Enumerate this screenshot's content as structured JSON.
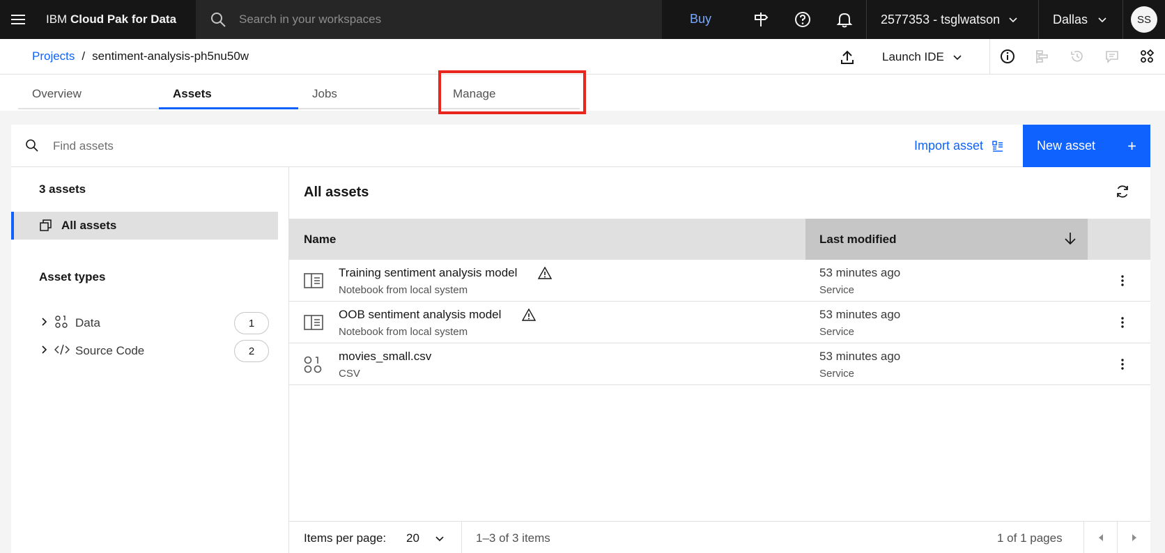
{
  "header": {
    "brand_prefix": "IBM",
    "brand_name": "Cloud Pak for Data",
    "search_placeholder": "Search in your workspaces",
    "buy_label": "Buy",
    "account": "2577353 - tsglwatson",
    "region": "Dallas",
    "avatar_initials": "SS"
  },
  "breadcrumb": {
    "root": "Projects",
    "separator": "/",
    "current": "sentiment-analysis-ph5nu50w"
  },
  "toolbar": {
    "launch_ide": "Launch IDE"
  },
  "tabs": [
    {
      "label": "Overview"
    },
    {
      "label": "Assets"
    },
    {
      "label": "Jobs"
    },
    {
      "label": "Manage"
    }
  ],
  "assetbar": {
    "find_placeholder": "Find assets",
    "import_label": "Import asset",
    "new_label": "New asset",
    "new_plus": "+"
  },
  "sidebar": {
    "count": "3 assets",
    "all_assets": "All assets",
    "types_heading": "Asset types",
    "types": [
      {
        "label": "Data",
        "count": "1"
      },
      {
        "label": "Source Code",
        "count": "2"
      }
    ]
  },
  "main": {
    "title": "All assets",
    "col_name": "Name",
    "col_modified": "Last modified",
    "rows": [
      {
        "name": "Training sentiment analysis model",
        "sub": "Notebook from local system",
        "time": "53 minutes ago",
        "by": "Service",
        "icon": "notebook-icon",
        "warning": true
      },
      {
        "name": "OOB sentiment analysis model",
        "sub": "Notebook from local system",
        "time": "53 minutes ago",
        "by": "Service",
        "icon": "notebook-icon",
        "warning": true
      },
      {
        "name": "movies_small.csv",
        "sub": "CSV",
        "time": "53 minutes ago",
        "by": "Service",
        "icon": "data-icon",
        "warning": false
      }
    ],
    "pager": {
      "items_per_page_label": "Items per page:",
      "items_per_page": "20",
      "range": "1–3 of 3 items",
      "pages": "1 of 1 pages"
    }
  },
  "colors": {
    "accent": "#0f62fe",
    "highlight": "#e8261d",
    "header_bg": "#161616"
  }
}
